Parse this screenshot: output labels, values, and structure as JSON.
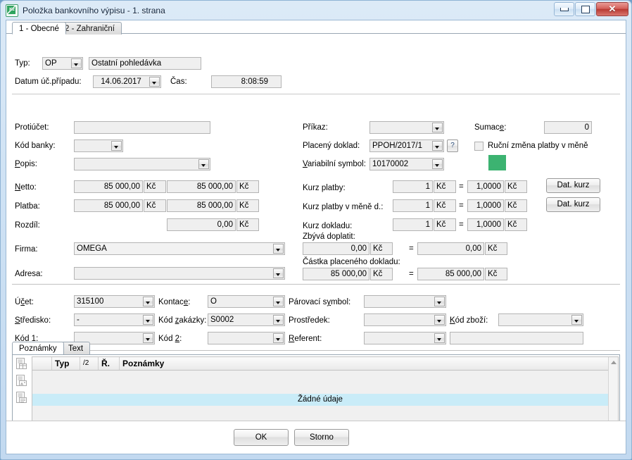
{
  "window": {
    "title": "Položka bankovního výpisu - 1. strana",
    "icon": "k2-app-icon",
    "controls": {
      "minimize": "minimize-icon",
      "restore": "restore-icon",
      "close": "✕"
    }
  },
  "tabs": [
    {
      "label": "1 - Obecné",
      "active": true
    },
    {
      "label": "2 - Zahraniční",
      "active": false
    }
  ],
  "form": {
    "typ": {
      "label": "Typ:",
      "value": "OP",
      "description": "Ostatní pohledávka"
    },
    "datum": {
      "label": "Datum úč.případu:",
      "value": "14.06.2017"
    },
    "cas": {
      "label": "Čas:",
      "value": "8:08:59"
    },
    "protiucet": {
      "label": "Protiúčet:",
      "value": ""
    },
    "kod_banky": {
      "label": "Kód banky:",
      "value": ""
    },
    "popis": {
      "label": "Popis:",
      "value": ""
    },
    "prikaz": {
      "label": "Příkaz:",
      "value": ""
    },
    "placeny_doklad": {
      "label": "Placený doklad:",
      "value": "PPOH/2017/1",
      "help": "?"
    },
    "variabilni_symbol": {
      "label": "Variabilní symbol:",
      "value": "10170002"
    },
    "sumace": {
      "label": "Sumace:",
      "value": "0"
    },
    "rucni_zmena": {
      "label": "Ruční změna platby v měně",
      "checked": false
    },
    "color_swatch": "#3cb371",
    "netto": {
      "label": "Netto:",
      "value1": "85 000,00",
      "unit1": "Kč",
      "value2": "85 000,00",
      "unit2": "Kč"
    },
    "platba": {
      "label": "Platba:",
      "value1": "85 000,00",
      "unit1": "Kč",
      "value2": "85 000,00",
      "unit2": "Kč"
    },
    "rozdil": {
      "label": "Rozdíl:",
      "value2": "0,00",
      "unit2": "Kč"
    },
    "kurz_platby": {
      "label": "Kurz platby:",
      "value1": "1",
      "unit1": "Kč",
      "eq": "=",
      "value2": "1,0000",
      "unit2": "Kč",
      "button": "Dat. kurz"
    },
    "kurz_platby_mene": {
      "label": "Kurz platby v měně d.:",
      "value1": "1",
      "unit1": "Kč",
      "eq": "=",
      "value2": "1,0000",
      "unit2": "Kč",
      "button": "Dat. kurz"
    },
    "kurz_dokladu": {
      "label": "Kurz dokladu:",
      "value1": "1",
      "unit1": "Kč",
      "eq": "=",
      "value2": "1,0000",
      "unit2": "Kč"
    },
    "firma": {
      "label": "Firma:",
      "value": "OMEGA"
    },
    "adresa": {
      "label": "Adresa:",
      "value": ""
    },
    "zbyva_doplatit": {
      "label": "Zbývá doplatit:",
      "value1": "0,00",
      "unit1": "Kč",
      "eq": "=",
      "value2": "0,00",
      "unit2": "Kč"
    },
    "castka_dokladu": {
      "label": "Částka placeného dokladu:",
      "value1": "85 000,00",
      "unit1": "Kč",
      "eq": "=",
      "value2": "85 000,00",
      "unit2": "Kč"
    },
    "ucet": {
      "label": "Účet:",
      "value": "315100"
    },
    "stredisko": {
      "label": "Středisko:",
      "value": "-"
    },
    "kod1": {
      "label": "Kód 1:",
      "value": ""
    },
    "kontace": {
      "label": "Kontace:",
      "value": "O"
    },
    "kod_zakazky": {
      "label": "Kód zakázky:",
      "value": "S0002"
    },
    "kod2": {
      "label": "Kód 2:",
      "value": ""
    },
    "parovaci_symbol": {
      "label": "Párovací symbol:",
      "value": ""
    },
    "prostredek": {
      "label": "Prostředek:",
      "value": ""
    },
    "referent": {
      "label": "Referent:",
      "value": ""
    },
    "referent_extra": {
      "value": ""
    },
    "kod_zbozi": {
      "label": "Kód zboží:",
      "value": ""
    }
  },
  "notes": {
    "tabs": [
      {
        "label": "Poznámky",
        "active": true
      },
      {
        "label": "Text",
        "active": false
      }
    ],
    "toolbar_icons": [
      "document-table-icon",
      "document-image-icon",
      "document-text-icon"
    ],
    "grid": {
      "columns": [
        "Typ",
        "Ř.",
        "Poznámky"
      ],
      "sort_indicator": "/2",
      "empty_message": "Žádné údaje",
      "rows": []
    }
  },
  "footer": {
    "ok": "OK",
    "storno": "Storno"
  }
}
